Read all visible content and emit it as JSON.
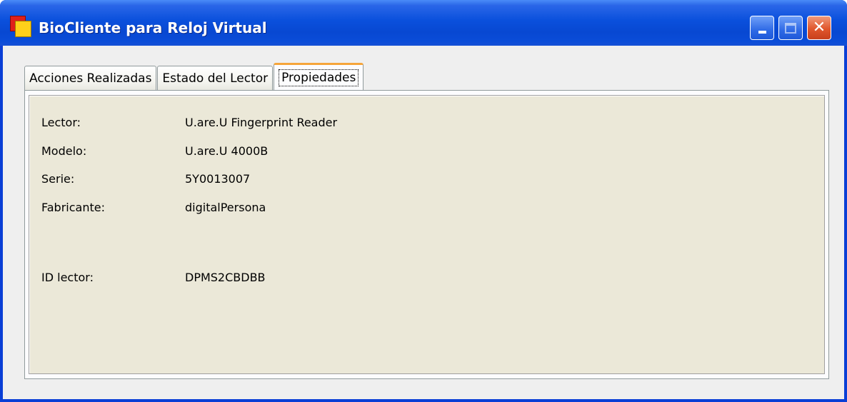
{
  "window": {
    "title": "BioCliente para Reloj Virtual",
    "icon": "app-icon",
    "controls": {
      "minimize": "minimize-icon",
      "maximize": "maximize-icon",
      "close": "close-icon"
    }
  },
  "tabs": [
    {
      "label": "Acciones Realizadas",
      "active": false
    },
    {
      "label": "Estado del Lector",
      "active": false
    },
    {
      "label": "Propiedades",
      "active": true
    }
  ],
  "properties": {
    "lector": {
      "label": "Lector:",
      "value": "U.are.U Fingerprint Reader"
    },
    "modelo": {
      "label": "Modelo:",
      "value": "U.are.U 4000B"
    },
    "serie": {
      "label": "Serie:",
      "value": "5Y0013007"
    },
    "fabricante": {
      "label": "Fabricante:",
      "value": "digitalPersona"
    },
    "id_lector": {
      "label": "ID lector:",
      "value": "DPMS2CBDBB"
    }
  },
  "colors": {
    "titlebar": "#0a50dc",
    "panel_bg": "#ebe8d8",
    "active_tab_accent": "#f6a53a",
    "close_button": "#e0562c"
  }
}
